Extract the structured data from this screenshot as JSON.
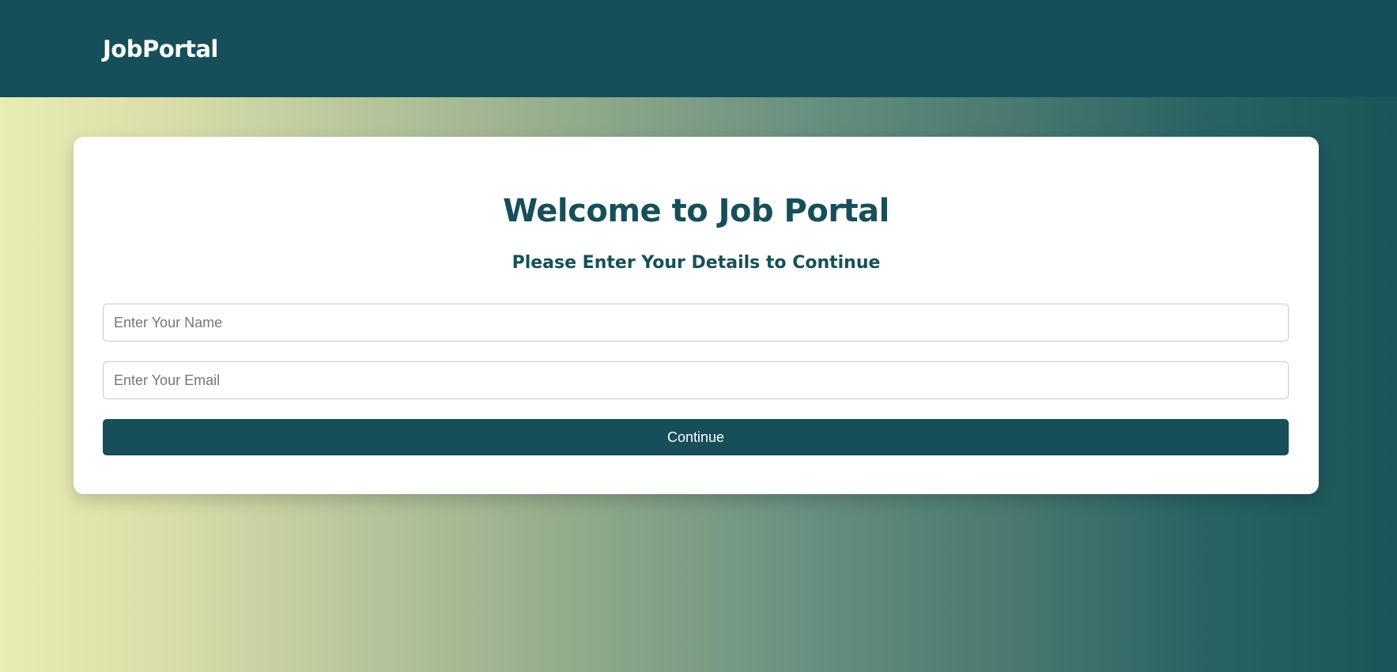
{
  "navbar": {
    "brand": "JobPortal"
  },
  "form": {
    "title": "Welcome to Job Portal",
    "subtitle": "Please Enter Your Details to Continue",
    "name_placeholder": "Enter Your Name",
    "name_value": "",
    "email_placeholder": "Enter Your Email",
    "email_value": "",
    "continue_label": "Continue"
  },
  "colors": {
    "primary": "#164f59",
    "card_background": "#ffffff",
    "gradient_start": "#e9ecb3",
    "gradient_end": "#1a5559"
  }
}
